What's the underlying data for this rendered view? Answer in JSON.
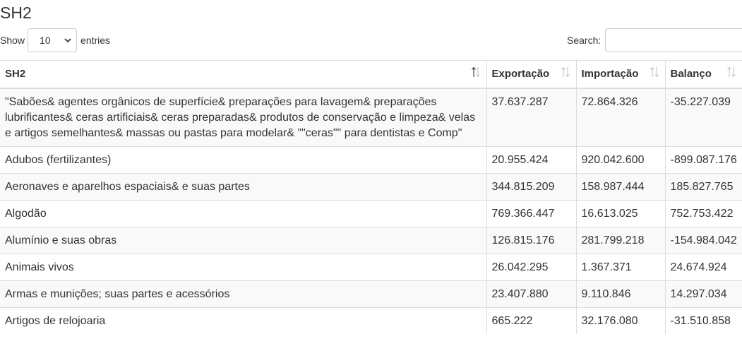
{
  "page": {
    "title": "SH2"
  },
  "length_control": {
    "show_label": "Show",
    "selected": "10",
    "entries_label": "entries"
  },
  "search": {
    "label": "Search:",
    "value": ""
  },
  "table": {
    "columns": [
      "SH2",
      "Exportação",
      "Importação",
      "Balanço"
    ],
    "rows": [
      [
        "\"Sabões& agentes orgânicos de superfície& preparações para lavagem& preparações lubrificantes& ceras artificiais& ceras preparadas& produtos de conservação e limpeza& velas e artigos semelhantes& massas ou pastas para modelar& \"\"ceras\"\" para dentistas e Comp\"",
        "37.637.287",
        "72.864.326",
        "-35.227.039"
      ],
      [
        "Adubos (fertilizantes)",
        "20.955.424",
        "920.042.600",
        "-899.087.176"
      ],
      [
        "Aeronaves e aparelhos espaciais& e suas partes",
        "344.815.209",
        "158.987.444",
        "185.827.765"
      ],
      [
        "Algodão",
        "769.366.447",
        "16.613.025",
        "752.753.422"
      ],
      [
        "Alumínio e suas obras",
        "126.815.176",
        "281.799.218",
        "-154.984.042"
      ],
      [
        "Animais vivos",
        "26.042.295",
        "1.367.371",
        "24.674.924"
      ],
      [
        "Armas e munições; suas partes e acessórios",
        "23.407.880",
        "9.110.846",
        "14.297.034"
      ],
      [
        "Artigos de relojoaria",
        "665.222",
        "32.176.080",
        "-31.510.858"
      ]
    ]
  }
}
